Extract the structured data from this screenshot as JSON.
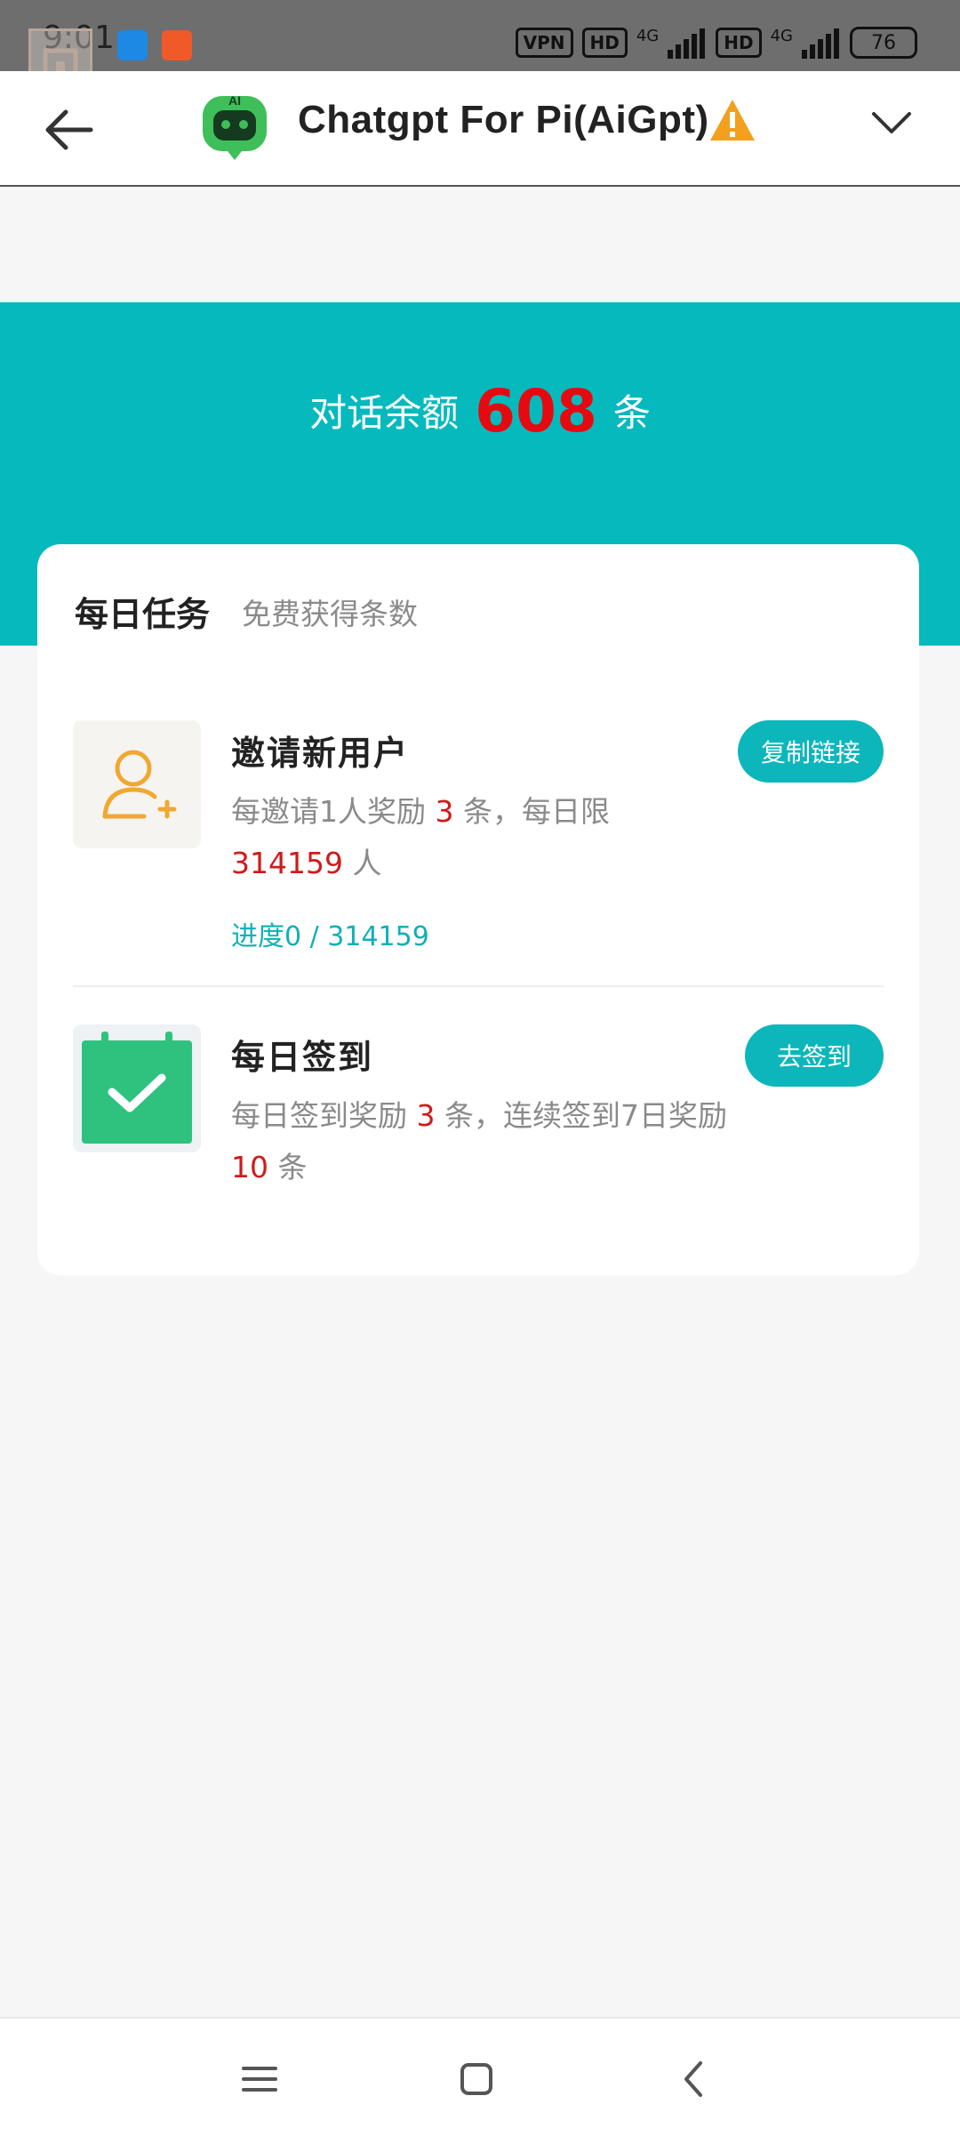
{
  "status_bar": {
    "time": "9:01",
    "indicators": [
      "VPN",
      "HD",
      "4G",
      "HD",
      "4G"
    ],
    "battery": "76"
  },
  "app_bar": {
    "title": "Chatgpt For Pi(AiGpt)",
    "logo_text": "AI",
    "icons": [
      "back-arrow-icon",
      "app-logo-icon",
      "warning-icon",
      "chevron-down-icon"
    ]
  },
  "balance": {
    "prefix": "对话余额",
    "amount": "608",
    "suffix": "条"
  },
  "daily_tasks": {
    "title": "每日任务",
    "subtitle": "免费获得条数",
    "invite": {
      "name": "邀请新用户",
      "desc_a": "每邀请1人奖励",
      "reward": "3",
      "desc_b": "条，每日限",
      "limit": "314159",
      "desc_c": "人",
      "progress": "进度0 / 314159",
      "button": "复制链接"
    },
    "checkin": {
      "name": "每日签到",
      "desc_a": "每日签到奖励",
      "reward": "3",
      "desc_b": "条，连续签到7日奖励",
      "bonus": "10",
      "desc_c": "条",
      "button": "去签到"
    }
  },
  "colors": {
    "accent": "#06b9bd",
    "highlight": "#e50a10",
    "invite_icon": "#f0a830",
    "checkin_icon": "#2ec27e"
  }
}
